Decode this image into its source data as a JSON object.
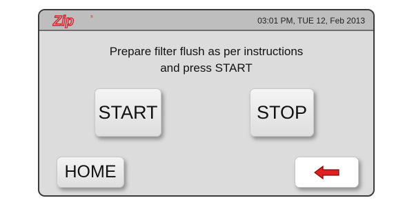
{
  "brand": {
    "logo_text": "Zip",
    "accent_color": "#d8232a"
  },
  "header": {
    "datetime": "03:01 PM, TUE 12, Feb 2013"
  },
  "message": {
    "line1": "Prepare filter flush as per instructions",
    "line2": "and press START"
  },
  "buttons": {
    "start_label": "START",
    "stop_label": "STOP",
    "home_label": "HOME",
    "back_icon": "left-arrow-icon"
  }
}
